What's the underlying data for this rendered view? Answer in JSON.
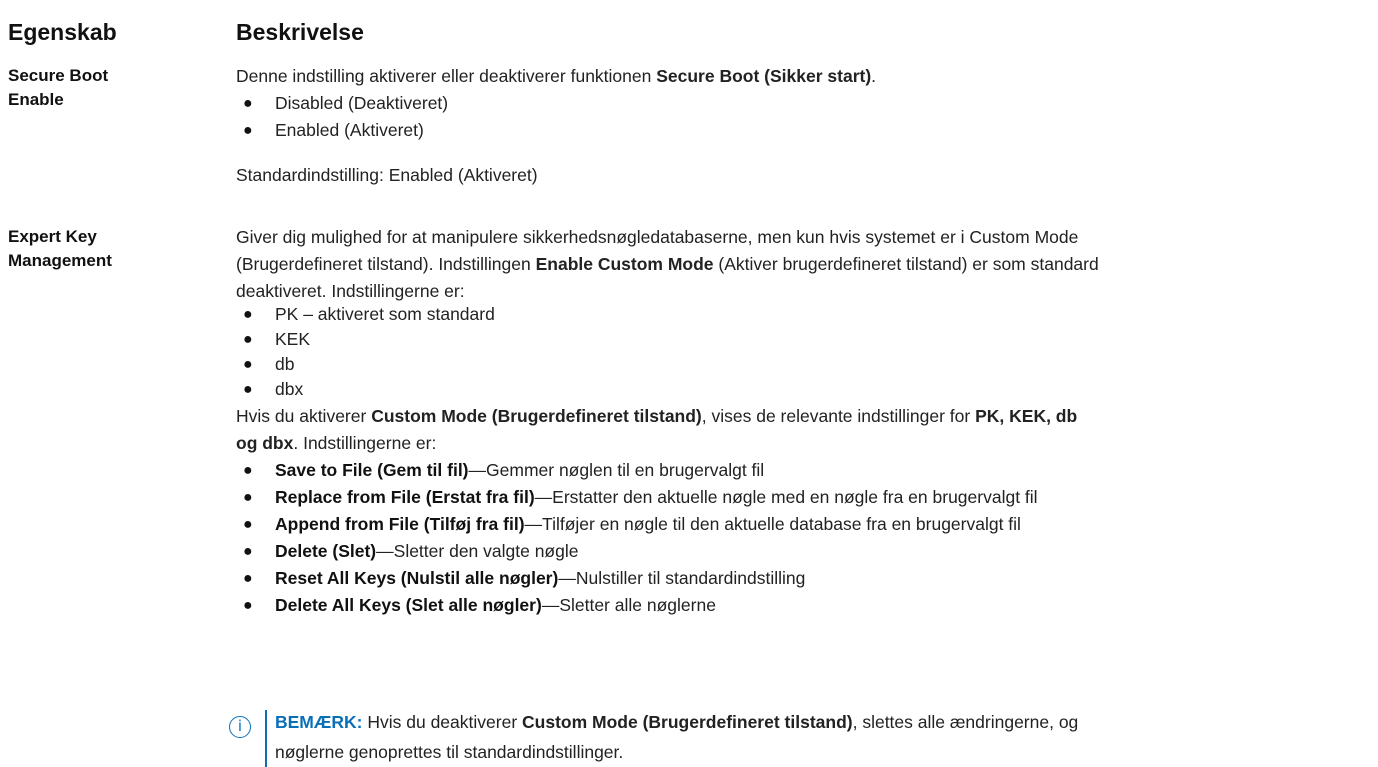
{
  "header": {
    "col1": "Egenskab",
    "col2": "Beskrivelse"
  },
  "row1": {
    "prop": [
      "Secure Boot",
      "Enable"
    ],
    "intro_pre": "Denne indstilling aktiverer eller deaktiverer funktionen ",
    "intro_bold": "Secure Boot (Sikker start)",
    "intro_post": ".",
    "options": [
      "Disabled (Deaktiveret)",
      "Enabled (Aktiveret)"
    ],
    "default": "Standardindstilling: Enabled (Aktiveret)"
  },
  "row2": {
    "prop": [
      "Expert Key",
      "Management"
    ],
    "p1_l1": "Giver dig mulighed for at manipulere sikkerhedsnøgledatabaserne, men kun hvis systemet er i Custom Mode",
    "p1_l2_pre": "(Brugerdefineret tilstand). Indstillingen ",
    "p1_l2_bold": "Enable Custom Mode",
    "p1_l2_post": " (Aktiver brugerdefineret tilstand) er som standard",
    "p1_l3": "deaktiveret. Indstillingerne er:",
    "keys": [
      "PK – aktiveret som standard",
      "KEK",
      "db",
      "dbx"
    ],
    "p2_l1_pre": "Hvis du aktiverer ",
    "p2_l1_bold": "Custom Mode (Brugerdefineret tilstand)",
    "p2_l1_mid": ", vises de relevante indstillinger for ",
    "p2_l1_bold2": "PK, KEK, db",
    "p2_l2_bold": "og dbx",
    "p2_l2_post": ". Indstillingerne er:",
    "actions": [
      {
        "bold": "Save to File (Gem til fil)",
        "text": "—Gemmer nøglen til en brugervalgt fil"
      },
      {
        "bold": "Replace from File (Erstat fra fil)",
        "text": "—Erstatter den aktuelle nøgle med en nøgle fra en brugervalgt fil"
      },
      {
        "bold": "Append from File (Tilføj fra fil)",
        "text": "—Tilføjer en nøgle til den aktuelle database fra en brugervalgt fil"
      },
      {
        "bold": "Delete (Slet)",
        "text": "—Sletter den valgte nøgle"
      },
      {
        "bold": "Reset All Keys (Nulstil alle nøgler)",
        "text": "—Nulstiller til standardindstilling"
      },
      {
        "bold": "Delete All Keys (Slet alle nøgler)",
        "text": "—Sletter alle nøglerne"
      }
    ],
    "note": {
      "label": "BEMÆRK:",
      "pre": " Hvis du deaktiverer ",
      "bold": "Custom Mode (Brugerdefineret tilstand)",
      "post": ", slettes alle ændringerne, og",
      "line2": "nøglerne genoprettes til standardindstillinger."
    }
  },
  "icons": {
    "note": "info-icon",
    "bullet": "bullet-dot"
  },
  "colors": {
    "note_accent": "#0b6fb8"
  }
}
